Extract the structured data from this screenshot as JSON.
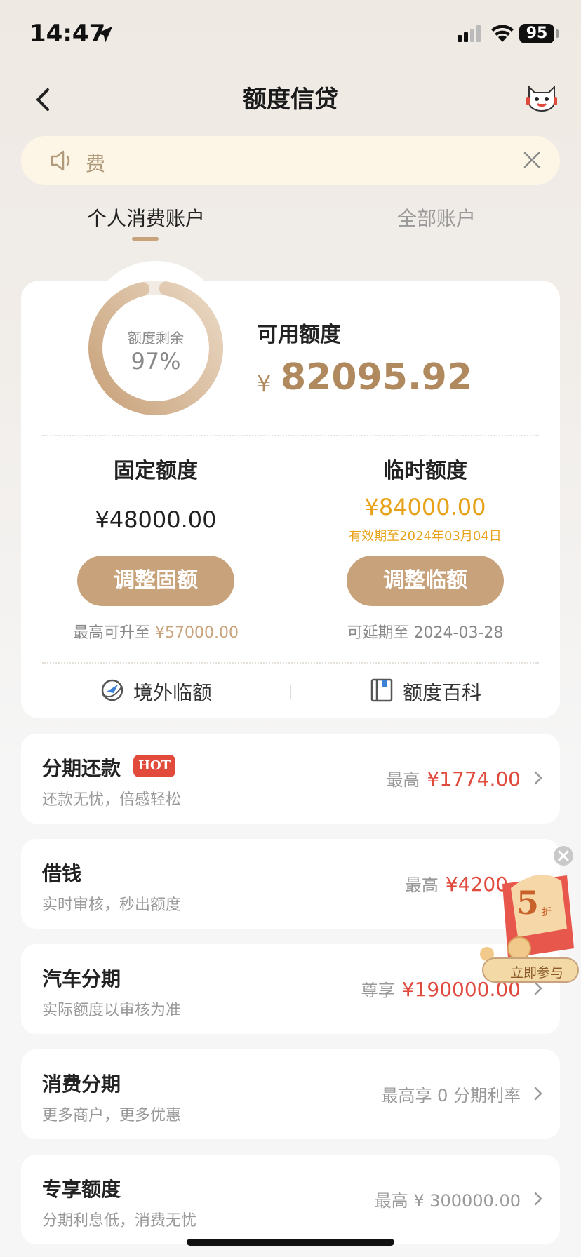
{
  "status_bar": {
    "time": "14:47",
    "battery": "95"
  },
  "nav": {
    "title": "额度信贷"
  },
  "notice": {
    "text": "费"
  },
  "tabs": [
    {
      "label": "个人消费账户"
    },
    {
      "label": "全部账户"
    }
  ],
  "summary": {
    "ring_label": "额度剩余",
    "ring_percent": "97%",
    "ring_fraction": 0.97,
    "available_label": "可用额度",
    "currency": "¥",
    "available_amount": "82095.92"
  },
  "fixed": {
    "title": "固定额度",
    "amount": "¥48000.00",
    "button": "调整固额",
    "note_prefix": "最高可升至 ",
    "note_value": "¥57000.00"
  },
  "temporary": {
    "title": "临时额度",
    "amount": "¥84000.00",
    "valid_until": "有效期至2024年03月04日",
    "button": "调整临额",
    "note": "可延期至 2024-03-28"
  },
  "links": [
    {
      "label": "境外临额"
    },
    {
      "label": "额度百科"
    }
  ],
  "rows": [
    {
      "title": "分期还款",
      "badge": "HOT",
      "subtitle": "还款无忧，倍感轻松",
      "right_prefix": "最高",
      "right_value": "¥1774.00"
    },
    {
      "title": "借钱",
      "subtitle": "实时审核，秒出额度",
      "right_prefix": "最高",
      "right_value": "¥4200"
    },
    {
      "title": "汽车分期",
      "subtitle": "实际额度以审核为准",
      "right_prefix": "尊享",
      "right_value": "¥190000.00"
    },
    {
      "title": "消费分期",
      "subtitle": "更多商户，更多优惠",
      "right_text": "最高享 0 分期利率"
    },
    {
      "title": "专享额度",
      "subtitle": "分期利息低，消费无忧",
      "right_text": "最高 ¥ 300000.00"
    }
  ],
  "promo": {
    "discount_number": "5",
    "discount_unit": "折",
    "button": "立即参与"
  },
  "colors": {
    "gold": "#c8a27a",
    "amount_gold": "#b08a5e",
    "orange": "#e8a21a",
    "red": "#e04a3c"
  }
}
